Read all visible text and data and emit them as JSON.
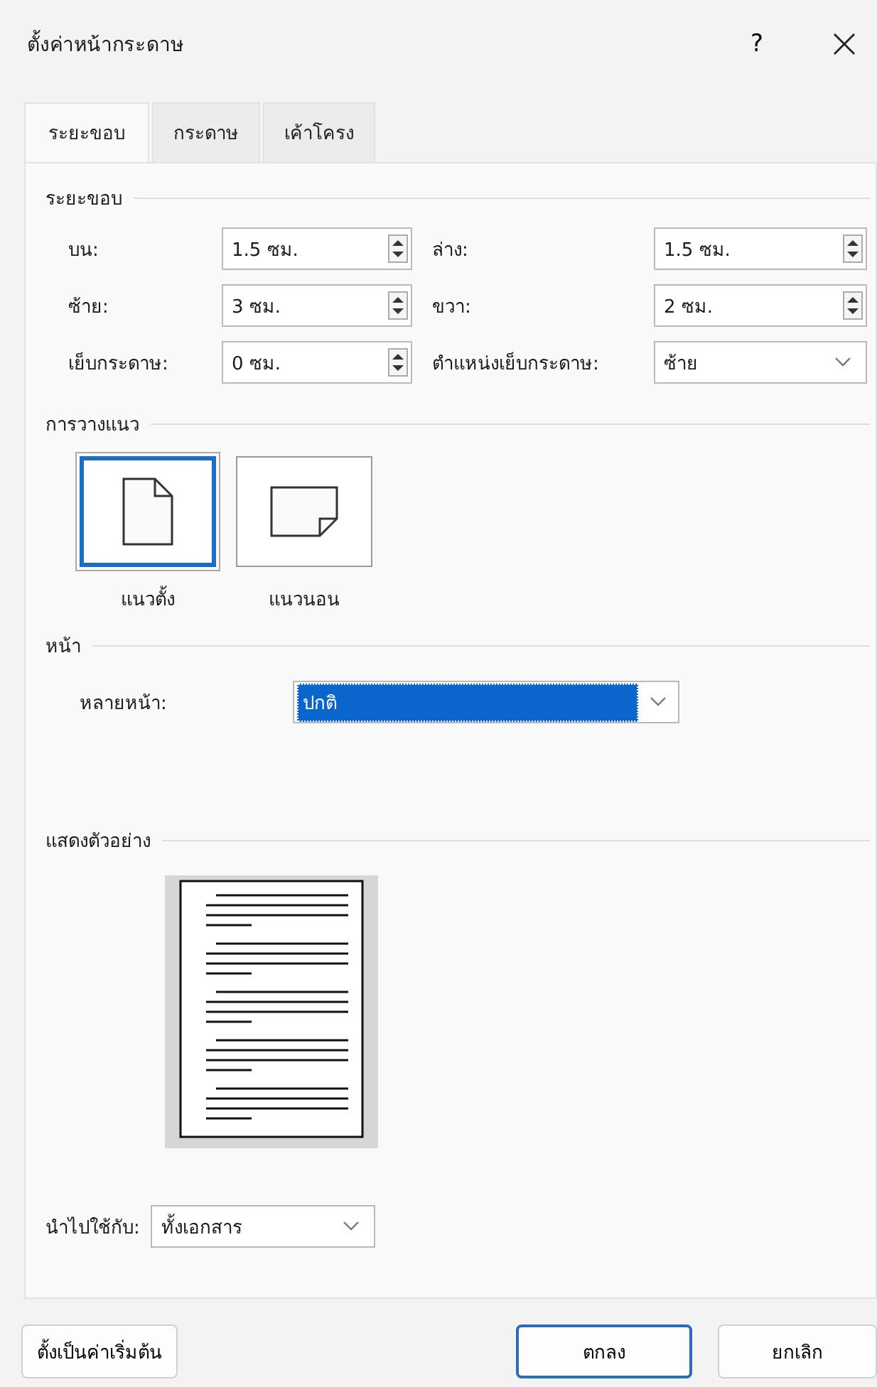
{
  "window": {
    "title": "ตั้งค่าหน้ากระดาษ",
    "help": "?"
  },
  "tabs": [
    {
      "label": "ระยะขอบ",
      "selected": true
    },
    {
      "label": "กระดาษ",
      "selected": false
    },
    {
      "label": "เค้าโครง",
      "selected": false
    }
  ],
  "margins": {
    "heading": "ระยะขอบ",
    "fields": [
      {
        "label": "บน:",
        "value": "1.5 ซม.",
        "kind": "spin"
      },
      {
        "label": "ล่าง:",
        "value": "1.5 ซม.",
        "kind": "spin"
      },
      {
        "label": "ซ้าย:",
        "value": "3 ซม.",
        "kind": "spin"
      },
      {
        "label": "ขวา:",
        "value": "2 ซม.",
        "kind": "spin"
      },
      {
        "label": "เย็บกระดาษ:",
        "value": "0 ซม.",
        "kind": "spin"
      },
      {
        "label": "ตำแหน่งเย็บกระดาษ:",
        "value": "ซ้าย",
        "kind": "select"
      }
    ]
  },
  "orientation": {
    "heading": "การวางแนว",
    "options": [
      {
        "label": "แนวตั้ง",
        "kind": "portrait",
        "selected": true
      },
      {
        "label": "แนวนอน",
        "kind": "landscape",
        "selected": false
      }
    ]
  },
  "pages": {
    "heading": "หน้า",
    "label": "หลายหน้า:",
    "value": "ปกติ",
    "focused": true
  },
  "preview": {
    "heading": "แสดงตัวอย่าง"
  },
  "apply_to": {
    "label": "นำไปใช้กับ:",
    "value": "ทั้งเอกสาร"
  },
  "buttons": [
    {
      "label": "ตั้งเป็นค่าเริ่มต้น",
      "focused": false
    },
    {
      "label": "ตกลง",
      "focused": true
    },
    {
      "label": "ยกเลิก",
      "focused": false
    }
  ]
}
